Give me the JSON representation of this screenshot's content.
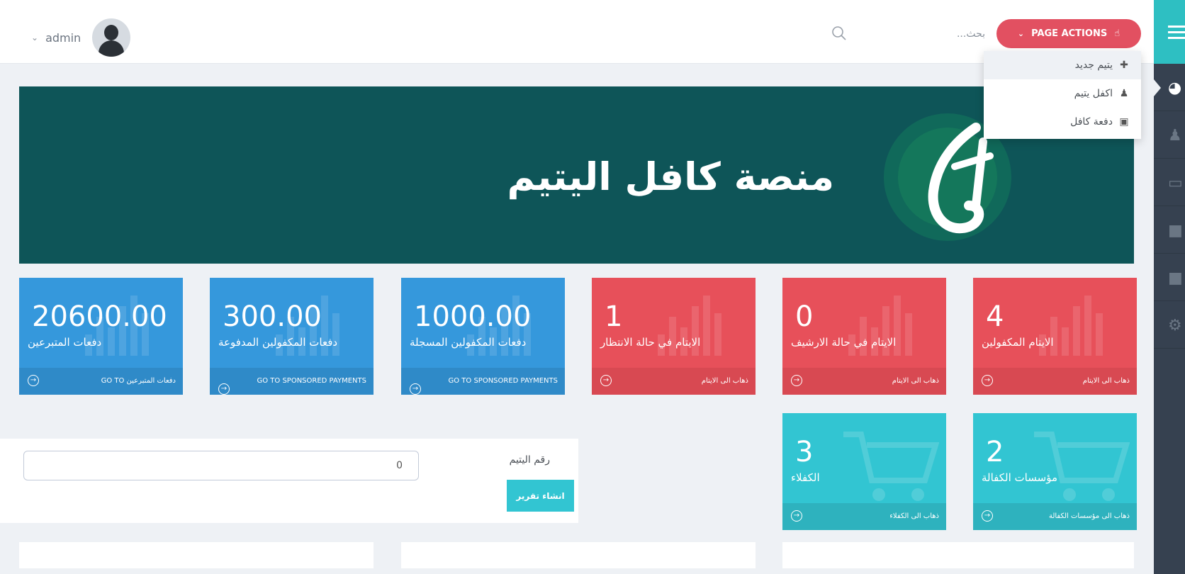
{
  "header": {
    "user_name": "admin",
    "search_placeholder": "بحث...",
    "page_actions_label": "PAGE ACTIONS"
  },
  "page_actions_menu": [
    {
      "icon": "plus-icon",
      "label": "يتيم جديد"
    },
    {
      "icon": "person-icon",
      "label": "اكفل يتيم"
    },
    {
      "icon": "money-icon",
      "label": "دفعة كافل"
    }
  ],
  "sidebar": {
    "items": [
      {
        "icon": "dashboard-icon",
        "active": true
      },
      {
        "icon": "person-icon",
        "active": false
      },
      {
        "icon": "credit-card-icon",
        "active": false
      },
      {
        "icon": "folder-icon",
        "active": false
      },
      {
        "icon": "folder-icon",
        "active": false
      },
      {
        "icon": "gear-icon",
        "active": false
      }
    ]
  },
  "banner": {
    "title": "منصة كافل اليتيم"
  },
  "tiles": [
    {
      "value": "20600.00",
      "label": "دفعات المتبرعين",
      "link": "GO TO دفعات المتبرعين",
      "color": "#3598dc"
    },
    {
      "value": "300.00",
      "label": "دفعات المكفولين المدفوعة",
      "link": "GO TO SPONSORED PAYMENTS",
      "color": "#3598dc"
    },
    {
      "value": "1000.00",
      "label": "دفعات المكفولين المسجلة",
      "link": "GO TO SPONSORED PAYMENTS",
      "color": "#3598dc"
    },
    {
      "value": "1",
      "label": "الايتام في حالة الانتظار",
      "link": "ذهاب الى الايتام",
      "color": "#e7505a"
    },
    {
      "value": "0",
      "label": "الايتام في حالة الارشيف",
      "link": "ذهاب الى الايتام",
      "color": "#e7505a"
    },
    {
      "value": "4",
      "label": "الايتام المكفولين",
      "link": "ذهاب الى الايتام",
      "color": "#e7505a"
    },
    {
      "value": "3",
      "label": "الكفلاء",
      "link": "ذهاب الى الكفلاء",
      "color": "#32c5d2"
    },
    {
      "value": "2",
      "label": "مؤسسات الكفالة",
      "link": "ذهاب الى مؤسسات الكفالة",
      "color": "#32c5d2"
    }
  ],
  "report": {
    "label": "رقم اليتيم",
    "input_value": "0",
    "button_label": "انشاء تقرير"
  },
  "colors": {
    "accent_teal": "#32c5d2",
    "accent_red": "#e7505a",
    "accent_blue": "#3598dc",
    "banner_bg": "#0e5558",
    "sidebar_bg": "#364150"
  }
}
